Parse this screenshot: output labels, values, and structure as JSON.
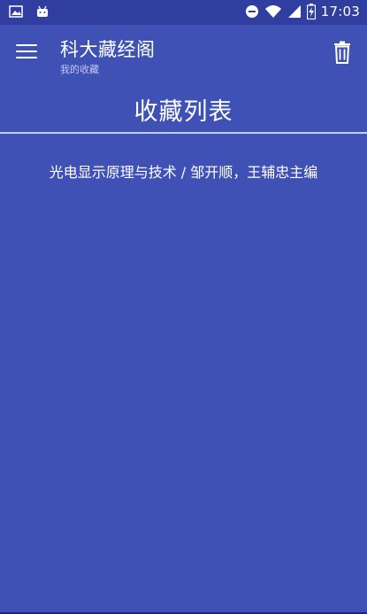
{
  "status_bar": {
    "time": "17:03",
    "left_icons": [
      "image-icon",
      "android-icon"
    ],
    "right_icons": [
      "do-not-disturb-icon",
      "wifi-icon",
      "signal-icon",
      "battery-icon"
    ]
  },
  "toolbar": {
    "title": "科大藏经阁",
    "subtitle": "我的收藏",
    "menu_icon": "menu-icon",
    "delete_icon": "trash-icon"
  },
  "favorites": {
    "heading": "收藏列表",
    "items": [
      {
        "text": "光电显示原理与技术 / 邹开顺，王辅忠主编"
      }
    ]
  },
  "colors": {
    "background": "#3f51b5",
    "status_bar": "#303f9f",
    "text": "#ffffff",
    "divider": "#c5cae9"
  }
}
